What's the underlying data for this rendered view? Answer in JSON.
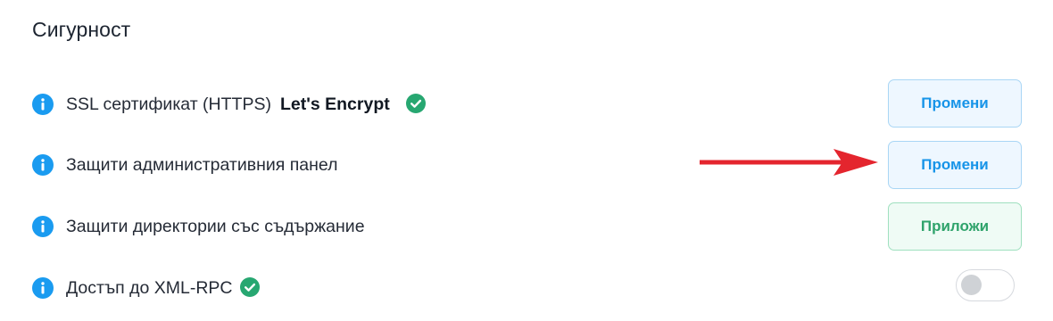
{
  "section": {
    "title": "Сигурност"
  },
  "rows": [
    {
      "label": "SSL сертификат (HTTPS)",
      "value": "Let's Encrypt",
      "status_icon": "check-circle-icon",
      "action_label": "Промени",
      "action_style": "blue"
    },
    {
      "label": "Защити административния панел",
      "action_label": "Промени",
      "action_style": "blue"
    },
    {
      "label": "Защити директории със съдържание",
      "action_label": "Приложи",
      "action_style": "green"
    },
    {
      "label": "Достъп до XML-RPC",
      "status_icon": "check-circle-icon",
      "toggle_state": "off"
    }
  ],
  "icons": {
    "info": "info-circle-icon",
    "arrow": "red-arrow-icon"
  },
  "colors": {
    "info_blue": "#1a9bf0",
    "check_green": "#27a771",
    "button_blue_text": "#1794e8",
    "button_green_text": "#2fa36b",
    "arrow_red": "#e4252e"
  }
}
